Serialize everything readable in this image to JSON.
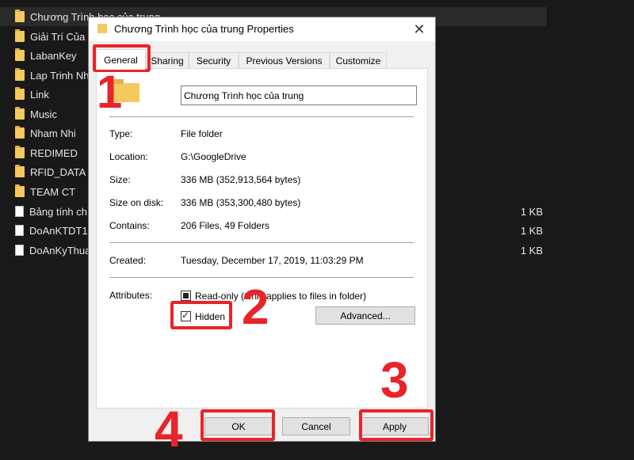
{
  "explorer": {
    "files": [
      {
        "name": "Chương Trình học của trung",
        "size": ""
      },
      {
        "name": "Giải Trí Của",
        "size": ""
      },
      {
        "name": "LabanKey",
        "size": ""
      },
      {
        "name": "Lap Trinh Nh",
        "size": ""
      },
      {
        "name": "Link",
        "size": ""
      },
      {
        "name": "Music",
        "size": ""
      },
      {
        "name": "Nham Nhi",
        "size": ""
      },
      {
        "name": "REDIMED",
        "size": ""
      },
      {
        "name": "RFID_DATA",
        "size": ""
      },
      {
        "name": "TEAM CT",
        "size": ""
      },
      {
        "name": "Bảng tính ch",
        "size": "1 KB"
      },
      {
        "name": "DoAnKTDT1",
        "size": "1 KB"
      },
      {
        "name": "DoAnKyThua",
        "size": "1 KB"
      }
    ]
  },
  "dialog": {
    "title": "Chương Trình học của trung Properties",
    "close_symbol": "✕",
    "tabs": [
      "General",
      "Sharing",
      "Security",
      "Previous Versions",
      "Customize"
    ],
    "folder_name": "Chương Trình học của trung",
    "info": {
      "type_label": "Type:",
      "type_value": "File folder",
      "location_label": "Location:",
      "location_value": "G:\\GoogleDrive",
      "size_label": "Size:",
      "size_value": "336 MB (352,913,564 bytes)",
      "size_on_disk_label": "Size on disk:",
      "size_on_disk_value": "336 MB (353,300,480 bytes)",
      "contains_label": "Contains:",
      "contains_value": "206 Files, 49 Folders",
      "created_label": "Created:",
      "created_value": "Tuesday, December 17, 2019, 11:03:29 PM"
    },
    "attributes": {
      "label": "Attributes:",
      "readonly_label": "Read-only (Only applies to files in folder)",
      "hidden_label": "Hidden",
      "advanced_button": "Advanced..."
    },
    "buttons": {
      "ok": "OK",
      "cancel": "Cancel",
      "apply": "Apply"
    }
  },
  "annotations": {
    "step1": "1",
    "step2": "2",
    "step3": "3",
    "step4": "4",
    "color": "#e8242a"
  }
}
